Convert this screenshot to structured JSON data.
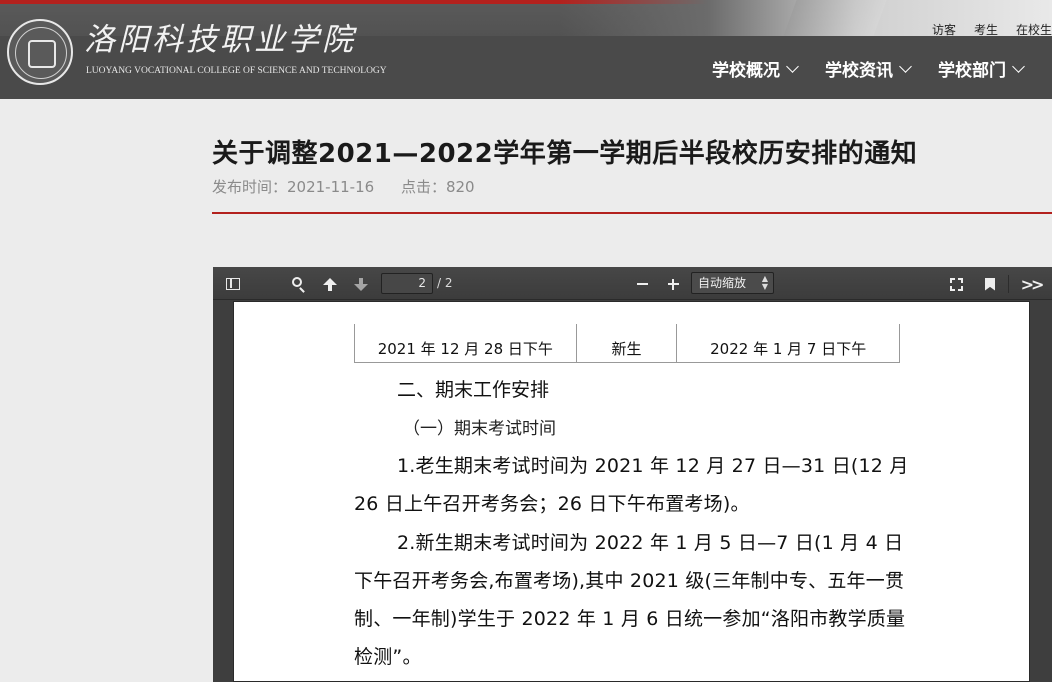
{
  "header": {
    "school_name": "洛阳科技职业学院",
    "school_name_en": "LUOYANG VOCATIONAL COLLEGE OF SCIENCE AND TECHNOLOGY",
    "top_links": [
      "访客",
      "考生",
      "在校生"
    ],
    "nav": [
      "学校概况",
      "学校资讯",
      "学校部门"
    ],
    "accent_color": "#b3211d"
  },
  "article": {
    "title": "关于调整2021—2022学年第一学期后半段校历安排的通知",
    "publish_time": "发布时间：2021-11-16",
    "clicks": "点击：820"
  },
  "pdf_viewer": {
    "page_current": "2",
    "page_total": "/ 2",
    "zoom": "自动缩放",
    "icons": [
      "sidebar-toggle-icon",
      "search-icon",
      "previous-page-icon",
      "next-page-icon",
      "zoom-out-icon",
      "zoom-in-icon",
      "fullscreen-icon",
      "bookmark-icon",
      "tools-icon"
    ]
  },
  "document": {
    "table_row": [
      "2021 年 12 月 28 日下午",
      "新生",
      "2022 年 1 月 7 日下午"
    ],
    "heading2": "二、期末工作安排",
    "heading3": "（一）期末考试时间",
    "para1": "1.老生期末考试时间为 2021 年 12 月 27 日—31 日(12 月 26 日上午召开考务会；26 日下午布置考场)。",
    "para2": "2.新生期末考试时间为 2022 年 1 月 5 日—7 日(1 月 4 日下午召开考务会,布置考场),其中 2021 级(三年制中专、五年一贯制、一年制)学生于 2022 年 1 月 6 日统一参加“洛阳市教学质量检测”。"
  }
}
